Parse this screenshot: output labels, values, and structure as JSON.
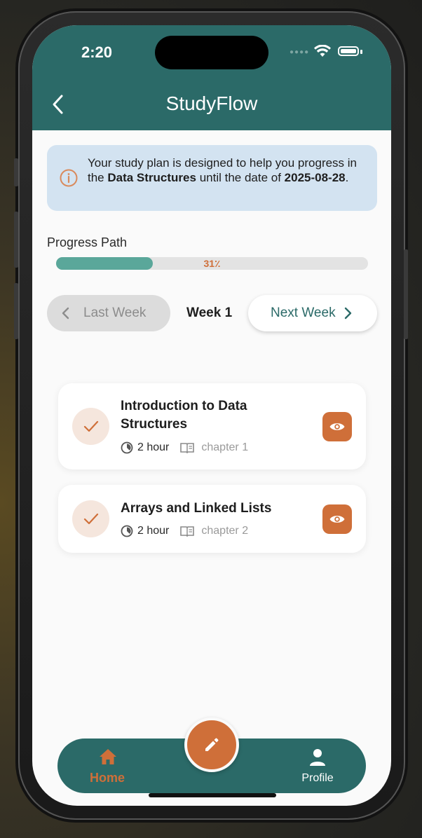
{
  "status_bar": {
    "time": "2:20"
  },
  "header": {
    "title": "StudyFlow",
    "back_icon": "chevron-left-icon"
  },
  "info_banner": {
    "prefix": "Your study plan is designed to help you progress in the ",
    "subject": "Data Structures",
    "middle": " until the date of ",
    "date": "2025-08-28",
    "suffix": "."
  },
  "progress": {
    "label": "Progress Path",
    "percent_text": "31٪",
    "value": 0.31,
    "fill_color": "#5aa79a"
  },
  "week_nav": {
    "prev_label": "Last Week",
    "current_label": "Week 1",
    "next_label": "Next Week"
  },
  "lessons": [
    {
      "title": "Introduction to Data Structures",
      "duration": "2 hour",
      "chapter": "chapter 1",
      "completed": true
    },
    {
      "title": "Arrays and Linked Lists",
      "duration": "2 hour",
      "chapter": "chapter 2",
      "completed": true
    }
  ],
  "bottom_nav": {
    "home_label": "Home",
    "profile_label": "Profile",
    "fab_icon": "pencil-icon"
  },
  "colors": {
    "primary": "#2b6a68",
    "accent": "#cf6f39",
    "info_bg": "#d3e3f1"
  }
}
